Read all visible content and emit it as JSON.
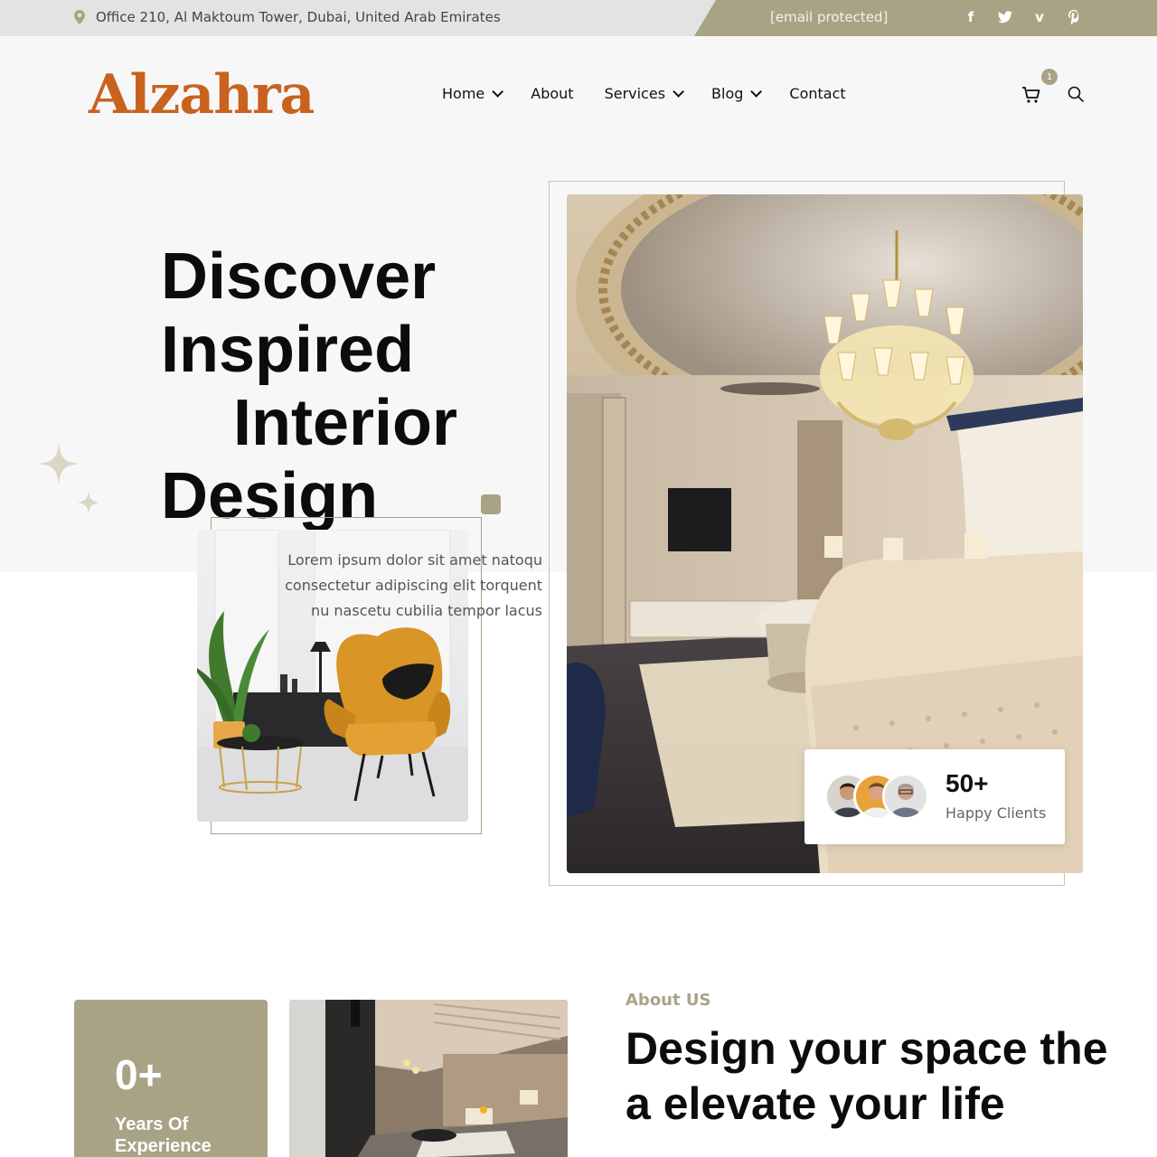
{
  "topbar": {
    "address": "Office 210, Al Maktoum Tower, Dubai, United Arab Emirates",
    "email": "[email protected]",
    "socials": [
      "facebook-icon",
      "twitter-icon",
      "vimeo-icon",
      "pinterest-icon"
    ]
  },
  "header": {
    "logo": "Alzahra",
    "nav": [
      {
        "label": "Home",
        "dropdown": true
      },
      {
        "label": "About",
        "dropdown": false
      },
      {
        "label": "Services",
        "dropdown": true
      },
      {
        "label": "Blog",
        "dropdown": true
      },
      {
        "label": "Contact",
        "dropdown": false
      }
    ],
    "cart_count": "1"
  },
  "hero": {
    "title_lines": [
      "Discover",
      "Inspired",
      "Interior",
      "Design"
    ],
    "description": "Lorem ipsum dolor sit amet natoqu consectetur adipiscing elit torquent nu nascetu cubilia tempor lacus",
    "clients_number": "50+",
    "clients_label": "Happy Clients"
  },
  "about": {
    "experience_number": "0+",
    "experience_label": "Years Of Experience",
    "tag": "About US",
    "title_lines": [
      "Design your space the",
      "a elevate your life"
    ]
  },
  "colors": {
    "accent": "#a9a386",
    "logo": "#c8621e",
    "topbar_bg": "#e3e3e3",
    "hero_bg": "#f7f7f7"
  }
}
